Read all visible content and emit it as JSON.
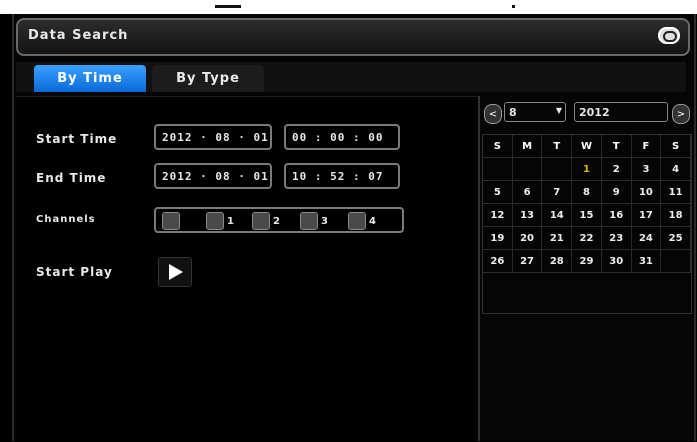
{
  "window": {
    "title": "Data Search"
  },
  "tabs": [
    {
      "label": "By Time",
      "active": true
    },
    {
      "label": "By Type",
      "active": false
    }
  ],
  "form": {
    "start_time_label": "Start Time",
    "start_date": "2012 · 08 · 01",
    "start_clock": "00 : 00 : 00",
    "end_time_label": "End Time",
    "end_date": "2012 · 08 · 01",
    "end_clock": "10 : 52 : 07",
    "channels_label": "Channels",
    "channels": [
      "",
      "1",
      "2",
      "3",
      "4"
    ],
    "start_play_label": "Start Play"
  },
  "calendar": {
    "prev": "<",
    "next": ">",
    "month": "8",
    "year": "2012",
    "weekdays": [
      "S",
      "M",
      "T",
      "W",
      "T",
      "F",
      "S"
    ],
    "days": [
      "",
      "",
      "",
      "1",
      "2",
      "3",
      "4",
      "5",
      "6",
      "7",
      "8",
      "9",
      "10",
      "11",
      "12",
      "13",
      "14",
      "15",
      "16",
      "17",
      "18",
      "19",
      "20",
      "21",
      "22",
      "23",
      "24",
      "25",
      "26",
      "27",
      "28",
      "29",
      "30",
      "31",
      ""
    ],
    "selected_day": "1",
    "colors": {
      "selected": "#d8b800",
      "tab_active": "#1e8cff"
    }
  }
}
